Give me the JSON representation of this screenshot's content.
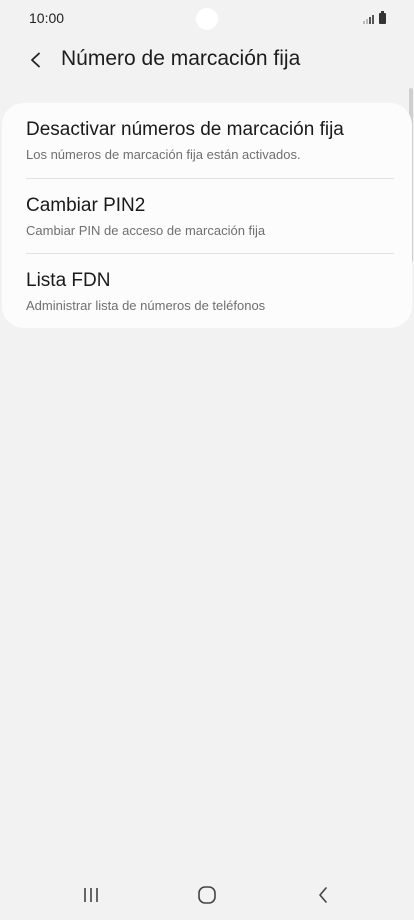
{
  "status_bar": {
    "time": "10:00",
    "signal_icon": "signal-icon",
    "battery_icon": "battery-icon"
  },
  "header": {
    "back_icon": "back-arrow-icon",
    "title": "Número de marcación fija"
  },
  "settings": {
    "items": [
      {
        "title": "Desactivar números de marcación fija",
        "subtitle": "Los números de marcación fija están activados."
      },
      {
        "title": "Cambiar PIN2",
        "subtitle": "Cambiar PIN de acceso de marcación fija"
      },
      {
        "title": "Lista FDN",
        "subtitle": "Administrar lista de números de teléfonos"
      }
    ]
  },
  "nav_bar": {
    "recents_icon": "recents-icon",
    "home_icon": "home-icon",
    "back_icon": "back-icon"
  },
  "colors": {
    "background": "#f2f2f2",
    "card": "#fcfcfc",
    "text_primary": "#1a1a1a",
    "text_secondary": "#6f6f6f"
  }
}
